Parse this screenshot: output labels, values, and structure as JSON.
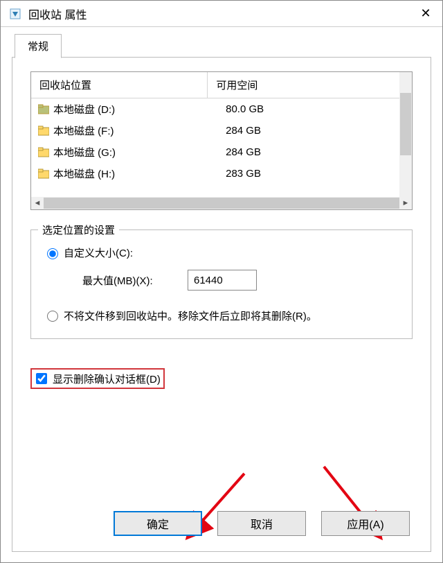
{
  "titlebar": {
    "title": "回收站 属性"
  },
  "tab": {
    "label": "常规"
  },
  "list": {
    "col1": "回收站位置",
    "col2": "可用空间",
    "rows": [
      {
        "label": "本地磁盘 (D:)",
        "val": "80.0 GB",
        "color": "#b8c17a"
      },
      {
        "label": "本地磁盘 (F:)",
        "val": "284 GB",
        "color": "#ffd86b"
      },
      {
        "label": "本地磁盘 (G:)",
        "val": "284 GB",
        "color": "#ffd86b"
      },
      {
        "label": "本地磁盘 (H:)",
        "val": "283 GB",
        "color": "#ffd86b"
      }
    ]
  },
  "fieldset": {
    "legend": "选定位置的设置",
    "radio_custom": "自定义大小(C):",
    "max_label": "最大值(MB)(X):",
    "max_value": "61440",
    "radio_no_recycle": "不将文件移到回收站中。移除文件后立即将其删除(R)。"
  },
  "checkbox": {
    "label": "显示删除确认对话框(D)"
  },
  "buttons": {
    "ok": "确定",
    "cancel": "取消",
    "apply": "应用(A)"
  }
}
